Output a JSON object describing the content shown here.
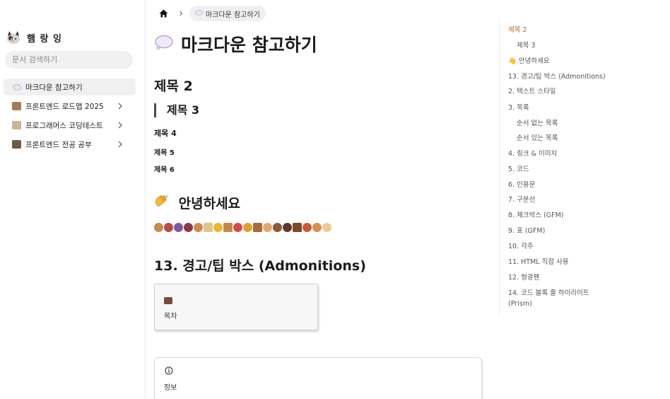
{
  "sidebar": {
    "brand_name": "햄 랑 잉",
    "search_placeholder": "문서 검색하기",
    "items": [
      {
        "label": "마크다운 참고하기",
        "active": true,
        "has_children": false,
        "icon": "thought-bubble-icon"
      },
      {
        "label": "프론트엔드 로드맵 2025",
        "active": false,
        "has_children": true,
        "icon": "thumbnail-icon"
      },
      {
        "label": "프로그래머스 코딩테스트",
        "active": false,
        "has_children": true,
        "icon": "thumbnail-icon"
      },
      {
        "label": "프론트엔드 전공 공부",
        "active": false,
        "has_children": true,
        "icon": "thumbnail-icon"
      }
    ]
  },
  "breadcrumb": {
    "home_icon": "home-icon",
    "current": "마크다운 참고하기"
  },
  "main": {
    "title": "마크다운 참고하기",
    "h2_1": "제목 2",
    "h3_1": "제목 3",
    "h4_1": "제목 4",
    "h5_1": "제목 5",
    "h6_1": "제목 6",
    "hello_heading": "안녕하세요",
    "admonitions_heading": "13. 경고/팁 박스 (Admonitions)",
    "toc_card_label": "목차",
    "info_card_label": "정보"
  },
  "right_toc": {
    "items": [
      {
        "label": "제목 2",
        "active": true,
        "sub": false
      },
      {
        "label": "제목 3",
        "active": false,
        "sub": true
      },
      {
        "label": "👋 안녕하세요",
        "active": false,
        "sub": false
      },
      {
        "label": "13. 경고/팁 박스 (Admonitions)",
        "active": false,
        "sub": false
      },
      {
        "label": "2. 텍스트 스타일",
        "active": false,
        "sub": false
      },
      {
        "label": "3. 목록",
        "active": false,
        "sub": false
      },
      {
        "label": "순서 없는 목록",
        "active": false,
        "sub": true
      },
      {
        "label": "순서 있는 목록",
        "active": false,
        "sub": true
      },
      {
        "label": "4. 링크 & 이미지",
        "active": false,
        "sub": false
      },
      {
        "label": "5. 코드",
        "active": false,
        "sub": false
      },
      {
        "label": "6. 인용문",
        "active": false,
        "sub": false
      },
      {
        "label": "7. 구분선",
        "active": false,
        "sub": false
      },
      {
        "label": "8. 체크박스 (GFM)",
        "active": false,
        "sub": false
      },
      {
        "label": "9. 표 (GFM)",
        "active": false,
        "sub": false
      },
      {
        "label": "10. 각주",
        "active": false,
        "sub": false
      },
      {
        "label": "11. HTML 직접 사용",
        "active": false,
        "sub": false
      },
      {
        "label": "12. 형광펜",
        "active": false,
        "sub": false
      },
      {
        "label": "14. 코드 블록 줄 하이라이트 (Prism)",
        "active": false,
        "sub": false
      }
    ]
  },
  "colors": {
    "accent": "#b06a32",
    "sidebar_active_bg": "#f0f0f0"
  }
}
